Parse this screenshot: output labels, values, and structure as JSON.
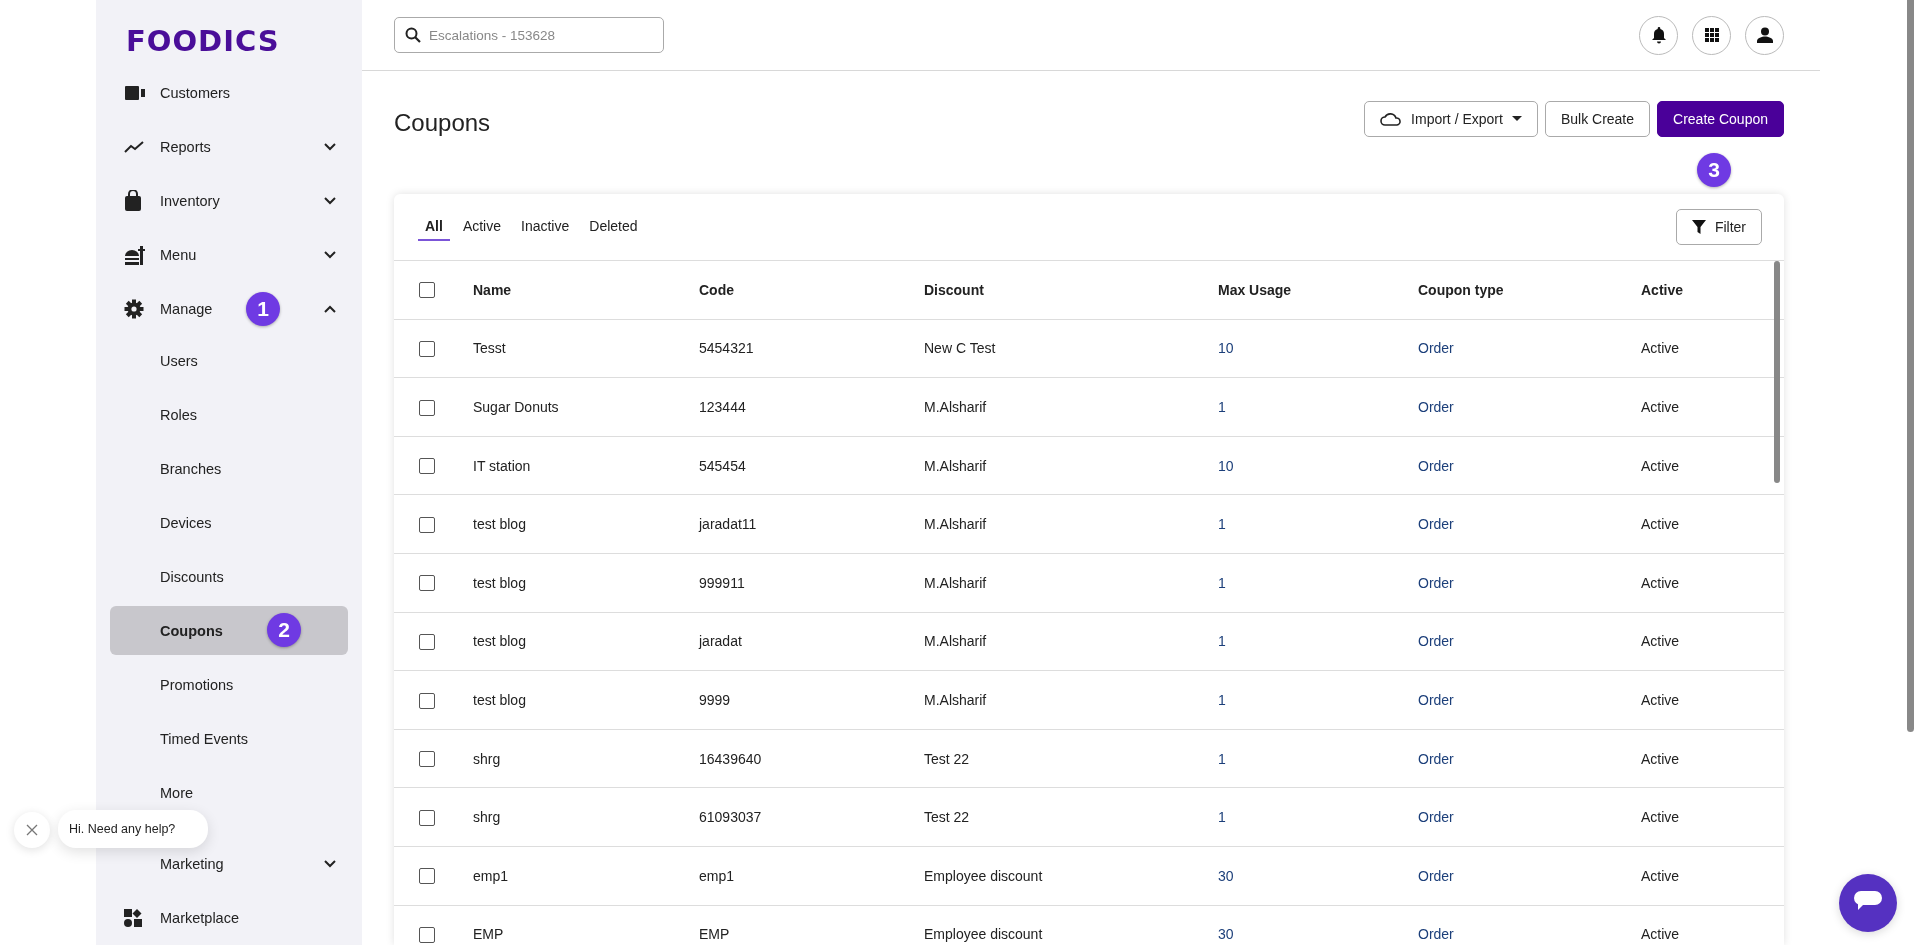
{
  "sidebar": {
    "logo": "FOODICS",
    "items": [
      {
        "label": "Customers",
        "kind": "link"
      },
      {
        "label": "Reports",
        "kind": "group",
        "expanded": false
      },
      {
        "label": "Inventory",
        "kind": "group",
        "expanded": false
      },
      {
        "label": "Menu",
        "kind": "group",
        "expanded": false
      },
      {
        "label": "Manage",
        "kind": "group",
        "expanded": true,
        "badge": "1",
        "children": [
          {
            "label": "Users",
            "selected": false
          },
          {
            "label": "Roles",
            "selected": false
          },
          {
            "label": "Branches",
            "selected": false
          },
          {
            "label": "Devices",
            "selected": false
          },
          {
            "label": "Discounts",
            "selected": false
          },
          {
            "label": "Coupons",
            "selected": true,
            "badge": "2"
          },
          {
            "label": "Promotions",
            "selected": false
          },
          {
            "label": "Timed Events",
            "selected": false
          },
          {
            "label": "More",
            "selected": false
          }
        ]
      },
      {
        "label": "Marketing",
        "kind": "group",
        "expanded": false
      },
      {
        "label": "Marketplace",
        "kind": "link"
      }
    ]
  },
  "search": {
    "placeholder": "Escalations - 153628"
  },
  "page_title": "Coupons",
  "actions": [
    {
      "label": "Import / Export",
      "kind": "menu"
    },
    {
      "label": "Bulk Create",
      "kind": "outline"
    },
    {
      "label": "Create Coupon",
      "kind": "primary",
      "badge": "3"
    }
  ],
  "tabs": [
    {
      "label": "All",
      "selected": true
    },
    {
      "label": "Active",
      "selected": false
    },
    {
      "label": "Inactive",
      "selected": false
    },
    {
      "label": "Deleted",
      "selected": false
    }
  ],
  "filter_button": "Filter",
  "table": {
    "all_checked": false,
    "columns": [
      "Name",
      "Code",
      "Discount",
      "Max Usage",
      "Coupon type",
      "Active"
    ],
    "rows": [
      {
        "checked": false,
        "cells": [
          "Tesst",
          "5454321",
          "New C Test",
          "10",
          "Order",
          "Active"
        ]
      },
      {
        "checked": false,
        "cells": [
          "Sugar Donuts",
          "123444",
          "M.Alsharif",
          "1",
          "Order",
          "Active"
        ]
      },
      {
        "checked": false,
        "cells": [
          "IT station",
          "545454",
          "M.Alsharif",
          "10",
          "Order",
          "Active"
        ]
      },
      {
        "checked": false,
        "cells": [
          "test blog",
          "jaradat11",
          "M.Alsharif",
          "1",
          "Order",
          "Active"
        ]
      },
      {
        "checked": false,
        "cells": [
          "test blog",
          "999911",
          "M.Alsharif",
          "1",
          "Order",
          "Active"
        ]
      },
      {
        "checked": false,
        "cells": [
          "test blog",
          "jaradat",
          "M.Alsharif",
          "1",
          "Order",
          "Active"
        ]
      },
      {
        "checked": false,
        "cells": [
          "test blog",
          "9999",
          "M.Alsharif",
          "1",
          "Order",
          "Active"
        ]
      },
      {
        "checked": false,
        "cells": [
          "shrg",
          "16439640",
          "Test 22",
          "1",
          "Order",
          "Active"
        ]
      },
      {
        "checked": false,
        "cells": [
          "shrg",
          "61093037",
          "Test 22",
          "1",
          "Order",
          "Active"
        ]
      },
      {
        "checked": false,
        "cells": [
          "emp1",
          "emp1",
          "Employee discount",
          "30",
          "Order",
          "Active"
        ]
      },
      {
        "checked": false,
        "cells": [
          "EMP",
          "EMP",
          "Employee discount",
          "30",
          "Order",
          "Active"
        ]
      }
    ]
  },
  "chat": {
    "message": "Hi. Need any help?"
  }
}
